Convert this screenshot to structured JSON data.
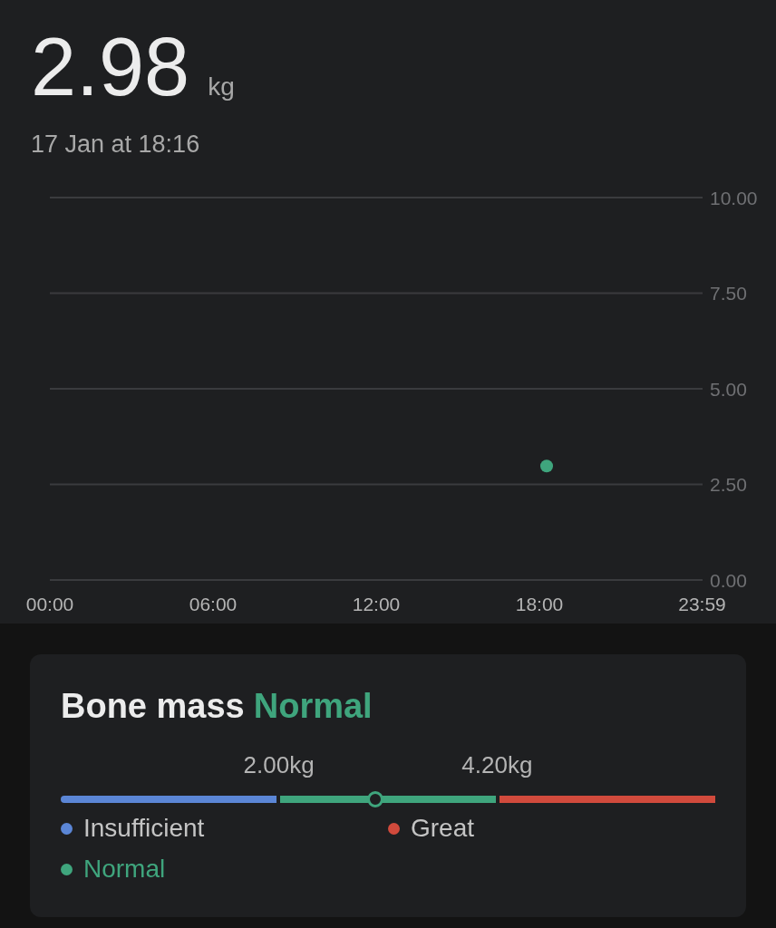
{
  "reading": {
    "value": "2.98",
    "unit": "kg",
    "timestamp": "17 Jan at 18:16"
  },
  "chart": {
    "chart_data": {
      "type": "scatter",
      "grid": true,
      "x": [
        1096
      ],
      "series": [
        {
          "color": "#3fa57d",
          "values": [
            2.98
          ]
        }
      ],
      "xlim": [
        0,
        1440
      ],
      "ylim": [
        0,
        10
      ],
      "xticks": [
        {
          "value": 0,
          "label": "00:00"
        },
        {
          "value": 360,
          "label": "06:00"
        },
        {
          "value": 720,
          "label": "12:00"
        },
        {
          "value": 1080,
          "label": "18:00"
        },
        {
          "value": 1439,
          "label": "23:59"
        }
      ],
      "yticks": [
        {
          "value": 10,
          "label": "10.00"
        },
        {
          "value": 7.5,
          "label": "7.50"
        },
        {
          "value": 5,
          "label": "5.00"
        },
        {
          "value": 2.5,
          "label": "2.50"
        },
        {
          "value": 0,
          "label": "0.00"
        }
      ]
    }
  },
  "card": {
    "title": "Bone mass",
    "status": "Normal",
    "scale": {
      "level": 0.48,
      "thresholds": [
        "2.00kg",
        "4.20kg"
      ]
    },
    "ranges": [
      {
        "label": "Insufficient",
        "color": "#5b86d6",
        "selected": false
      },
      {
        "label": "Normal",
        "color": "#3fa57d",
        "selected": true
      },
      {
        "label": "Great",
        "color": "#d14a3c",
        "selected": false
      }
    ]
  }
}
